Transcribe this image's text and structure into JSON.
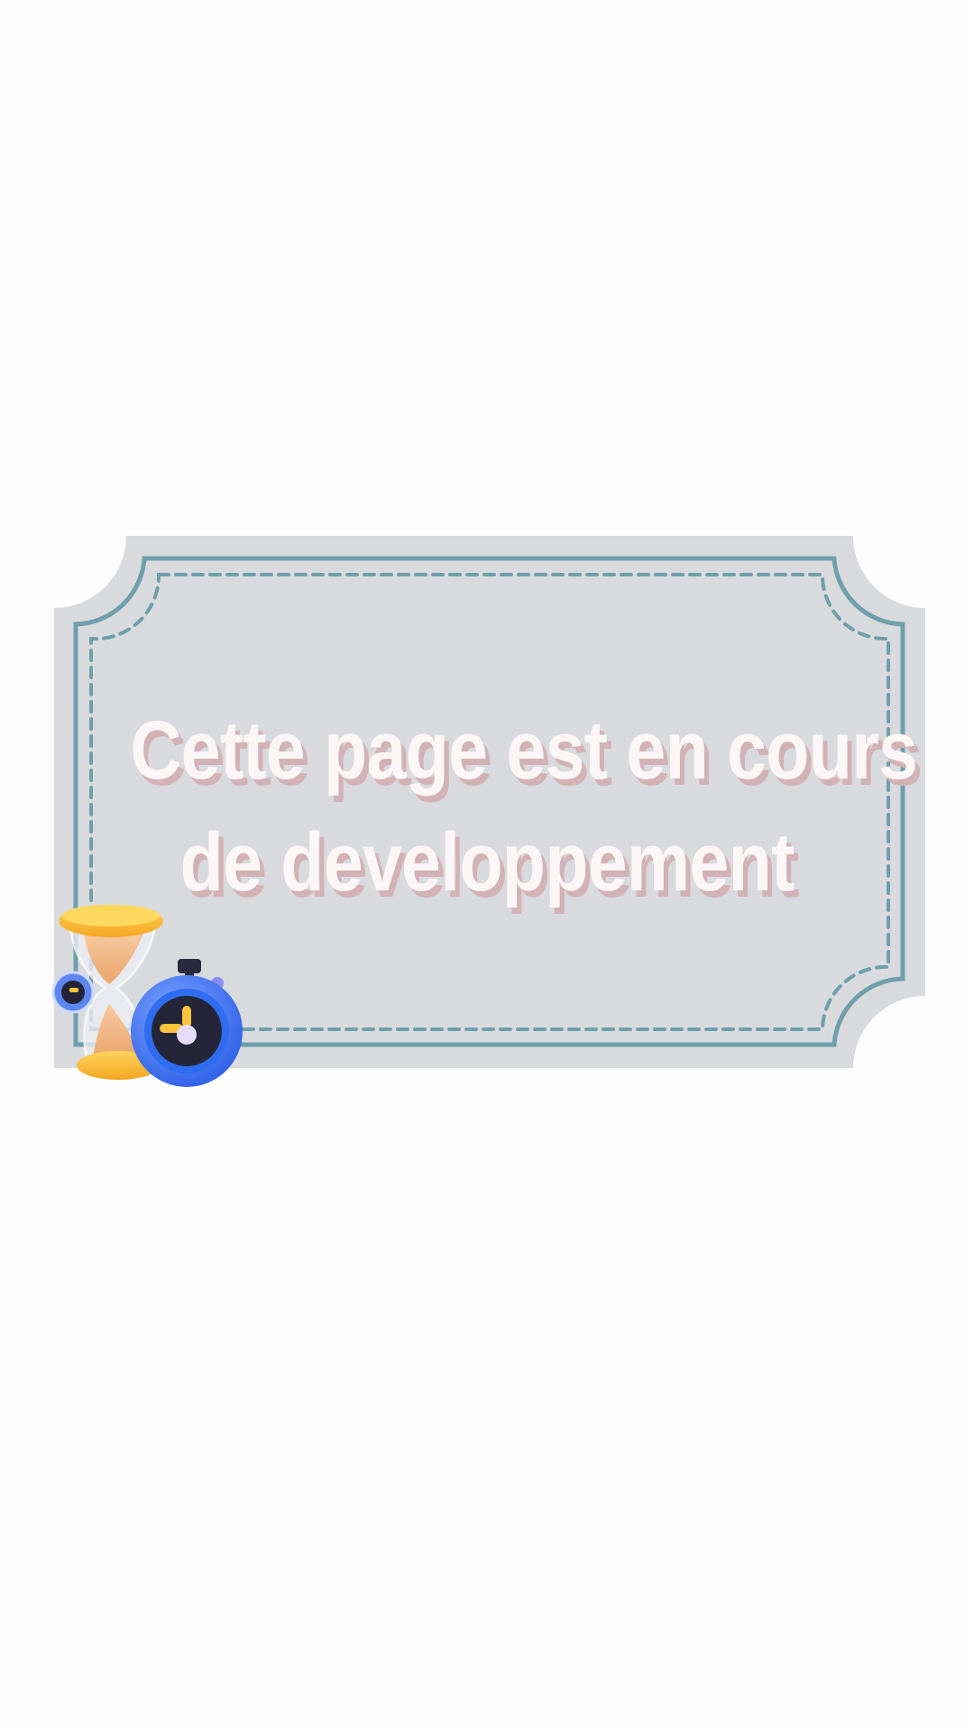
{
  "page": {
    "background_color": "#fdfdfd"
  },
  "notice": {
    "line1": "Cette page est en cours",
    "line2": "de developpement",
    "text_color": "#fcf6f6",
    "shadow_color": "#d2b2b5",
    "card_color": "#d9dadd",
    "border_color": "#6e9fab"
  },
  "illustration": {
    "icons": [
      "hourglass-icon",
      "stopwatch-icon"
    ]
  }
}
